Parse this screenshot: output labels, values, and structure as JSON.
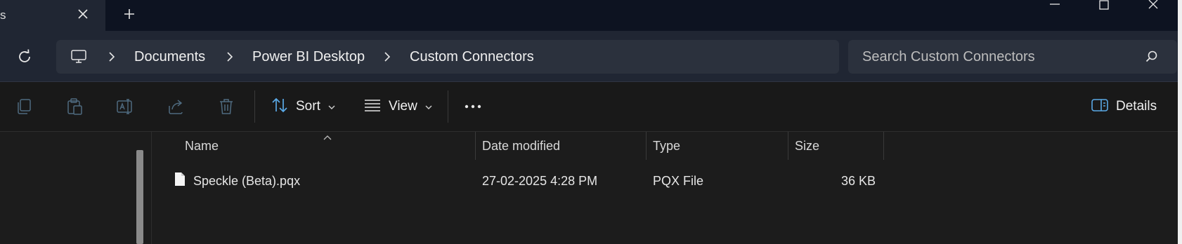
{
  "titlebar": {
    "tab_title": "s",
    "tab_close_icon": "close-icon",
    "new_tab_icon": "plus-icon",
    "window_controls": [
      "minimize-icon",
      "maximize-icon",
      "close-icon"
    ]
  },
  "address_bar": {
    "refresh_icon": "refresh-icon",
    "root_icon": "this-pc-icon",
    "breadcrumb": [
      "Documents",
      "Power BI Desktop",
      "Custom Connectors"
    ],
    "separator_icon": "chevron-right-icon"
  },
  "search": {
    "placeholder": "Search Custom Connectors",
    "icon": "search-icon"
  },
  "command_bar": {
    "icons": [
      "copy-icon",
      "paste-icon",
      "rename-icon",
      "share-icon",
      "delete-icon"
    ],
    "sort_label": "Sort",
    "view_label": "View",
    "more_icon": "more-icon",
    "details_label": "Details"
  },
  "file_list": {
    "columns": [
      "Name",
      "Date modified",
      "Type",
      "Size"
    ],
    "sorted_by": "Name",
    "rows": [
      {
        "name": "Speckle (Beta).pqx",
        "date_modified": "27-02-2025 4:28 PM",
        "type": "PQX File",
        "size": "36 KB"
      }
    ]
  },
  "colors": {
    "titlebar_bg": "#0d1321",
    "address_bg": "#202633",
    "field_bg": "#2b313d",
    "content_bg": "#1c1c1c"
  }
}
